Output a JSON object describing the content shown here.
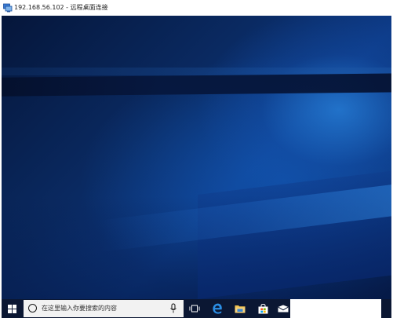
{
  "window": {
    "title": "192.168.56.102 - 远程桌面连接",
    "icon": "remote-desktop-icon"
  },
  "taskbar": {
    "start_icon": "windows-logo-icon",
    "search": {
      "placeholder": "在这里输入你要搜索的内容",
      "icon": "cortana-circle-icon",
      "mic_icon": "microphone-icon"
    },
    "pinned": [
      {
        "name": "task-view-icon"
      },
      {
        "name": "edge-icon"
      },
      {
        "name": "file-explorer-icon"
      },
      {
        "name": "store-icon"
      },
      {
        "name": "mail-icon"
      }
    ],
    "colors": {
      "taskbar": "#0b1733",
      "edge": "#1e88e5",
      "explorer": "#f2c14e"
    }
  }
}
